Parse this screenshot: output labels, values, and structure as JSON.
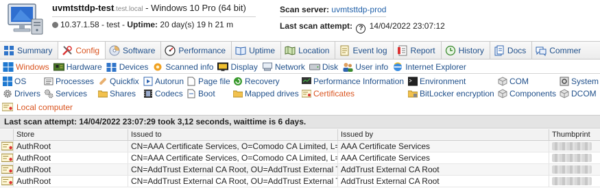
{
  "header": {
    "host_name": "uvmtsttdp-test",
    "host_domain": ".test.local",
    "host_os": " - Windows 10 Pro (64 bit)",
    "ip_status": "10.37.1.58 - test - ",
    "uptime_label": "Uptime:",
    "uptime_value": " 20 day(s) 19 h 21 m",
    "scan_server_label": "Scan server:",
    "scan_server_value": "uvmtsttdp-prod",
    "last_scan_label": "Last scan attempt:",
    "last_scan_value": "14/04/2022 23:07:12"
  },
  "main_tabs": [
    {
      "label": "Summary",
      "icon": "grid-icon",
      "active": false
    },
    {
      "label": "Config",
      "icon": "tools-icon",
      "active": true
    },
    {
      "label": "Software",
      "icon": "cd-icon",
      "active": false
    },
    {
      "label": "Performance",
      "icon": "gauge-icon",
      "active": false
    },
    {
      "label": "Uptime",
      "icon": "book-icon",
      "active": false
    },
    {
      "label": "Location",
      "icon": "map-icon",
      "active": false
    },
    {
      "label": "Event log",
      "icon": "note-icon",
      "active": false
    },
    {
      "label": "Report",
      "icon": "report-icon",
      "active": false
    },
    {
      "label": "History",
      "icon": "history-icon",
      "active": false
    },
    {
      "label": "Docs",
      "icon": "docs-icon",
      "active": false
    },
    {
      "label": "Commer",
      "icon": "comment-icon",
      "active": false
    }
  ],
  "sub_tabs": [
    {
      "label": "Windows",
      "icon": "windows-icon",
      "active": true
    },
    {
      "label": "Hardware",
      "icon": "board-icon",
      "active": false
    },
    {
      "label": "Devices",
      "icon": "devices-icon",
      "active": false
    },
    {
      "label": "Scanned info",
      "icon": "star-icon",
      "active": false
    },
    {
      "label": "Display",
      "icon": "display-icon",
      "active": false
    },
    {
      "label": "Network",
      "icon": "network-icon",
      "active": false
    },
    {
      "label": "Disk",
      "icon": "disk-icon",
      "active": false
    },
    {
      "label": "User info",
      "icon": "users-icon",
      "active": false
    },
    {
      "label": "Internet Explorer",
      "icon": "globe-icon",
      "active": false
    }
  ],
  "items": {
    "os": "OS",
    "processes": "Processes",
    "quickfix": "Quickfix",
    "autorun": "Autorun",
    "page_file": "Page file",
    "recovery": "Recovery",
    "performance_information": "Performance Information",
    "environment": "Environment",
    "com": "COM",
    "system": "System",
    "drivers": "Drivers",
    "services": "Services",
    "shares": "Shares",
    "codecs": "Codecs",
    "boot": "Boot",
    "mapped_drives": "Mapped drives",
    "certificates": "Certificates",
    "bitlocker": "BitLocker encryption",
    "components": "Components",
    "dcom": "DCOM",
    "local_computer": "Local computer"
  },
  "status": "Last scan attempt: 14/04/2022 23:07:29 took 3,12 seconds, waittime is 6 days.",
  "table": {
    "columns": [
      "Store",
      "Issued to",
      "Issued by",
      "Thumbprint"
    ],
    "rows": [
      {
        "store": "AuthRoot",
        "issued_to": "CN=AAA Certificate Services, O=Comodo CA Limited, L=Salford, S=Greater Manchester, C=GB",
        "issued_by": "AAA Certificate Services"
      },
      {
        "store": "AuthRoot",
        "issued_to": "CN=AAA Certificate Services, O=Comodo CA Limited, L=Salford, S=Greater Manchester, C=GB",
        "issued_by": "AAA Certificate Services"
      },
      {
        "store": "AuthRoot",
        "issued_to": "CN=AddTrust External CA Root, OU=AddTrust External TTP Network, O=AddTrust AB, C=SE",
        "issued_by": "AddTrust External CA Root"
      },
      {
        "store": "AuthRoot",
        "issued_to": "CN=AddTrust External CA Root, OU=AddTrust External TTP Network, O=AddTrust AB, C=SE",
        "issued_by": "AddTrust External CA Root"
      }
    ]
  },
  "colors": {
    "link": "#1f4f8a",
    "active": "#d9531e",
    "status_bg": "#e4e4e4"
  }
}
